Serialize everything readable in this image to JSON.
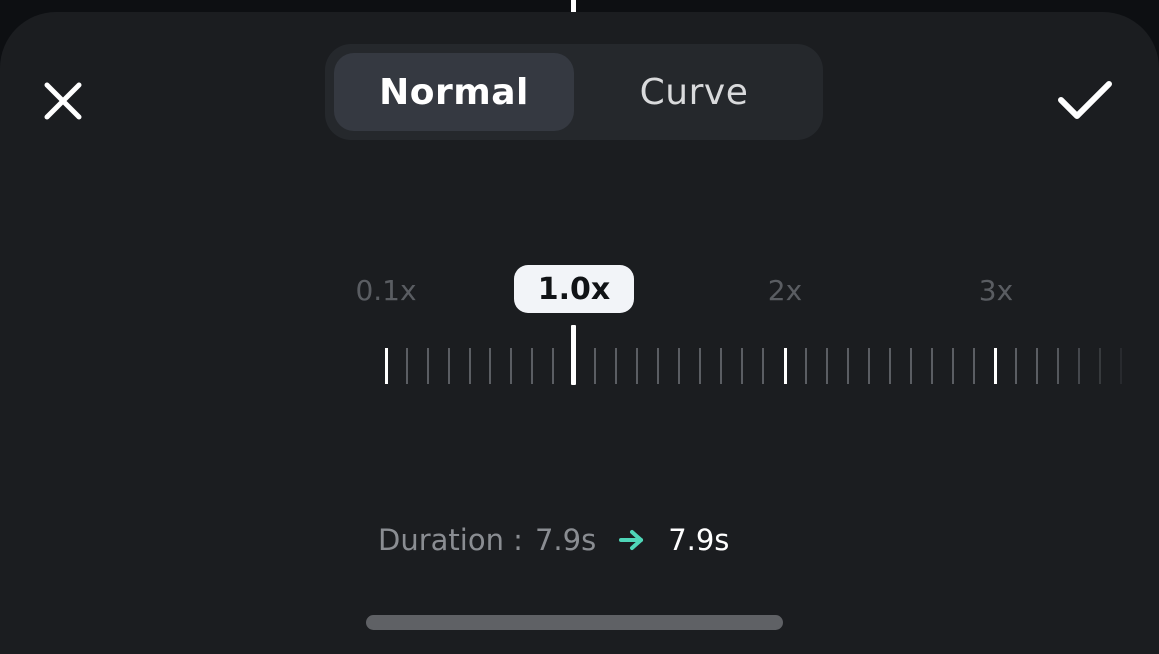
{
  "header": {
    "tabs": [
      {
        "label": "Normal",
        "selected": true
      },
      {
        "label": "Curve",
        "selected": false
      }
    ],
    "close_icon": "close-icon",
    "confirm_icon": "checkmark-icon"
  },
  "speed": {
    "current_label": "1.0x",
    "current_value": 1.0,
    "min_value": 0.1,
    "marks": [
      {
        "label": "0.1x",
        "value": 0.1
      },
      {
        "label": "2x",
        "value": 2
      },
      {
        "label": "3x",
        "value": 3
      }
    ]
  },
  "duration": {
    "label": "Duration :",
    "original": "7.9s",
    "new": "7.9s",
    "arrow_icon": "arrow-right-icon",
    "arrow_color": "#4fd6b8"
  },
  "colors": {
    "sheet_background": "#1b1d20",
    "selected_tab": "#353941",
    "pill": "#f2f4f8"
  }
}
